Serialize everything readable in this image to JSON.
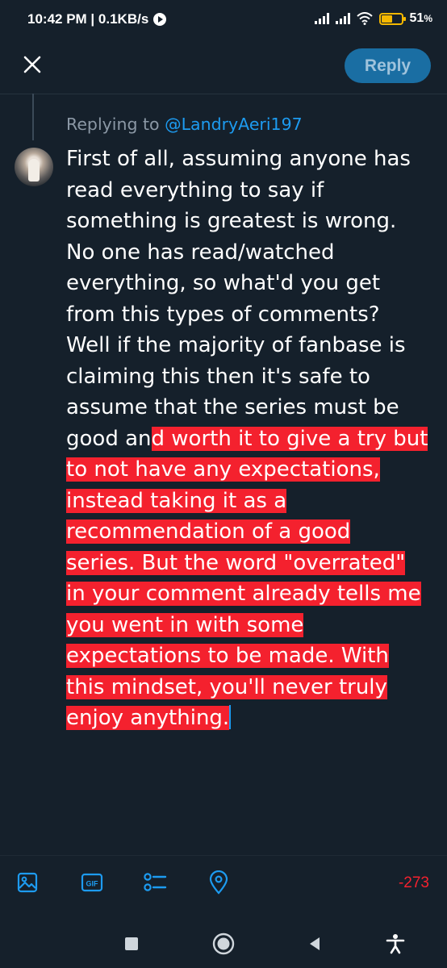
{
  "status_bar": {
    "time_speed": "10:42 PM | 0.1KB/s",
    "battery_percent": "51",
    "battery_symbol": "%"
  },
  "header": {
    "reply_label": "Reply"
  },
  "compose": {
    "replying_prefix": "Replying to",
    "replying_handle": "@LandryAeri197",
    "lines_normal": [
      "First of all, assuming anyone has",
      "read everything to say if",
      "something is greatest is wrong.",
      "No one has read/watched",
      "everything, so what'd you get",
      "from this types of comments?",
      "Well if the majority of fanbase is",
      "claiming this then it's safe to",
      "assume that the series must be"
    ],
    "split_line_normal": "good an",
    "split_line_overflow": "d worth it to give a try but",
    "lines_overflow": [
      "to not have any expectations,",
      "instead taking it as a",
      "recommendation of a good",
      "series. But the word \"overrated\"",
      "in your comment already tells me",
      "you went in with some",
      "expectations to be made. With",
      "this mindset, you'll never truly",
      "enjoy anything."
    ]
  },
  "toolbar": {
    "char_count": "-273",
    "gif_label": "GIF",
    "icons": [
      "image-icon",
      "gif-icon",
      "poll-icon",
      "location-icon"
    ]
  },
  "colors": {
    "background": "#15202b",
    "accent": "#1d9bf0",
    "overflow_highlight": "#f4212e",
    "reply_button": "#1a6ea3",
    "battery": "#f5b800"
  }
}
